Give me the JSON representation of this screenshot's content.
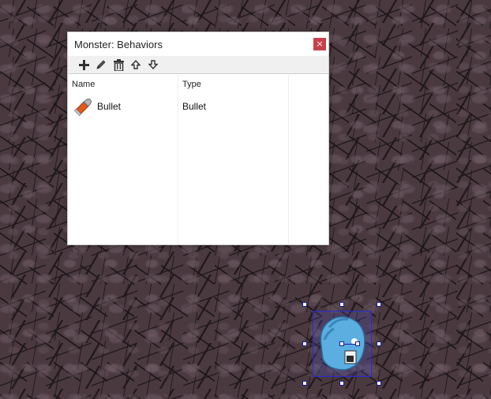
{
  "dialog": {
    "title": "Monster: Behaviors",
    "close_glyph": "×",
    "toolbar": {
      "buttons": [
        {
          "name": "add",
          "icon": "plus-icon"
        },
        {
          "name": "edit",
          "icon": "pencil-icon"
        },
        {
          "name": "delete",
          "icon": "trash-icon"
        },
        {
          "name": "move-up",
          "icon": "arrow-up-icon"
        },
        {
          "name": "move-down",
          "icon": "arrow-down-icon"
        }
      ]
    },
    "columns": [
      "Name",
      "Type"
    ],
    "rows": [
      {
        "name": "Bullet",
        "type": "Bullet",
        "icon": "bullet-icon"
      }
    ]
  },
  "canvas": {
    "background": "cracked-earth-texture",
    "selected_object": {
      "icon": "monster-sprite",
      "selection_color": "#2a2ad0"
    }
  }
}
